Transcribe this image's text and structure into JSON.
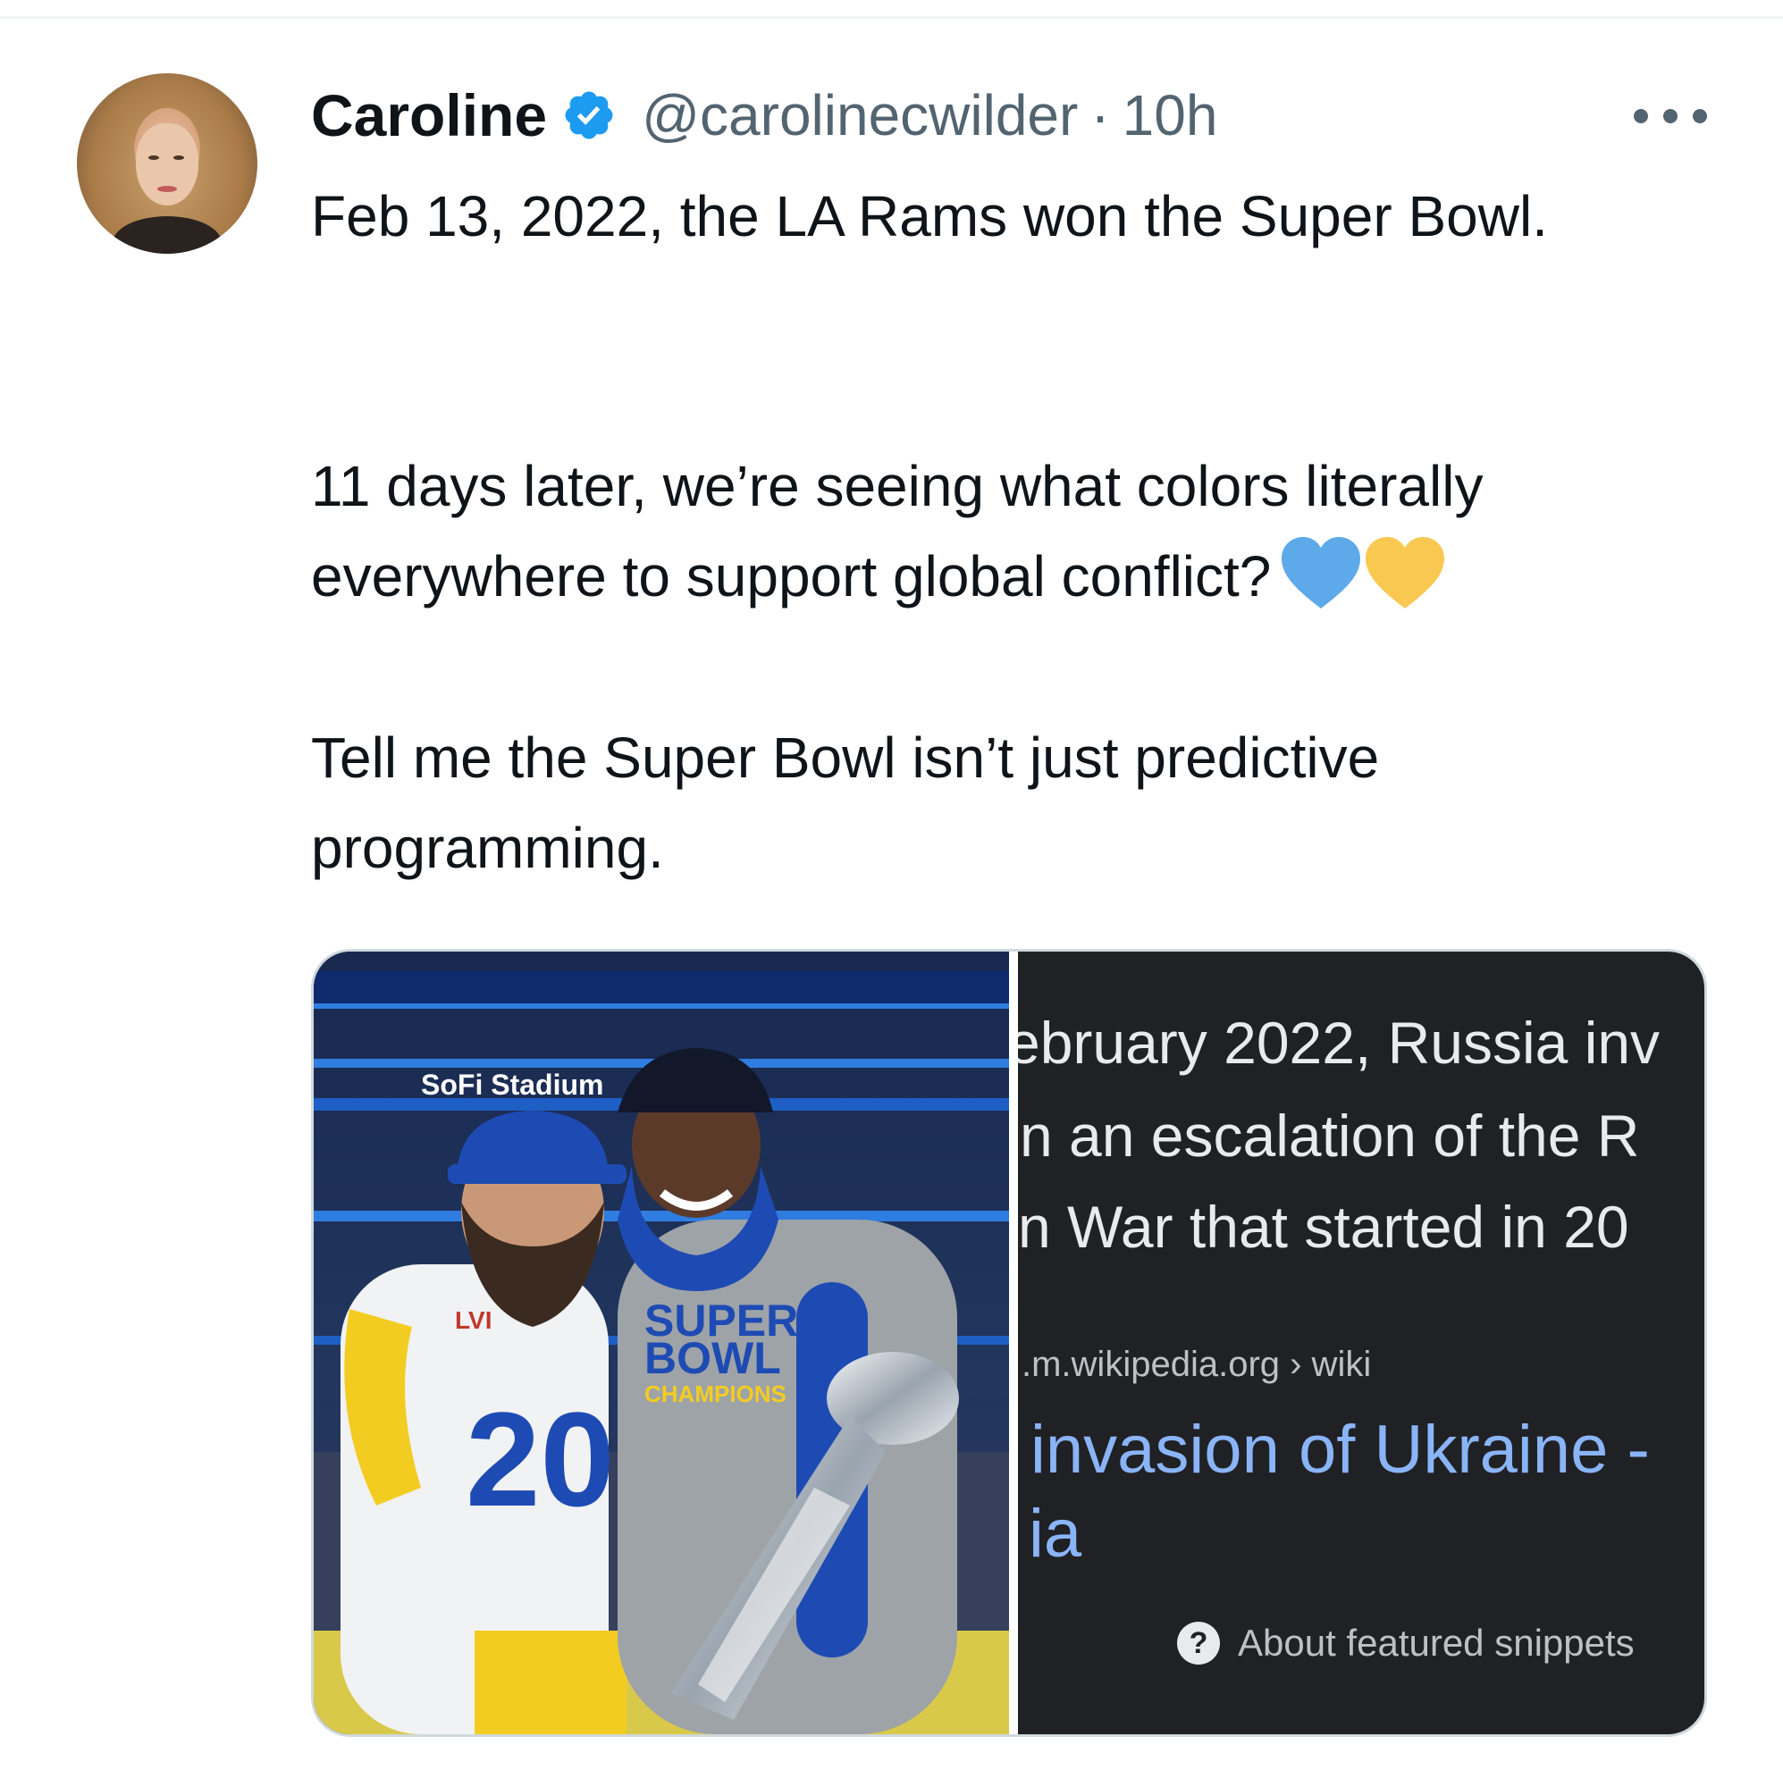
{
  "author": {
    "name": "Caroline",
    "handle": "@carolinecwilder",
    "separator": "·",
    "time": "10h",
    "verified": true
  },
  "tweet": {
    "line1": "Feb 13, 2022, the LA Rams won the Super Bowl.",
    "line2": "11 days later, we’re seeing what colors literally everywhere to support global conflict?",
    "line3": "Tell me the Super Bowl isn’t just predictive programming.",
    "emoji": [
      "blue-heart",
      "yellow-heart"
    ]
  },
  "media": {
    "photo": {
      "stadium_sign": "SoFi Stadium",
      "jersey_number": "20",
      "shirt_text": [
        "SUPER",
        "BOWL",
        "CHAMPIONS"
      ],
      "patch": "LVI"
    },
    "snippet": {
      "line1": "ebruary 2022, Russia inv",
      "line2": "n an escalation of the R",
      "line3": "n War that started in 20",
      "source": ".m.wikipedia.org › wiki",
      "title_line1": "invasion of Ukraine -",
      "title_line2": "ia",
      "help_icon_glyph": "?",
      "about_label": "About featured snippets"
    }
  },
  "colors": {
    "verified_blue": "#1d9bf0",
    "text_primary": "#0f1419",
    "text_secondary": "#536471",
    "link_blue": "#8ab4f8",
    "heart_blue": "#5da9e9",
    "heart_yellow": "#f8c851"
  }
}
